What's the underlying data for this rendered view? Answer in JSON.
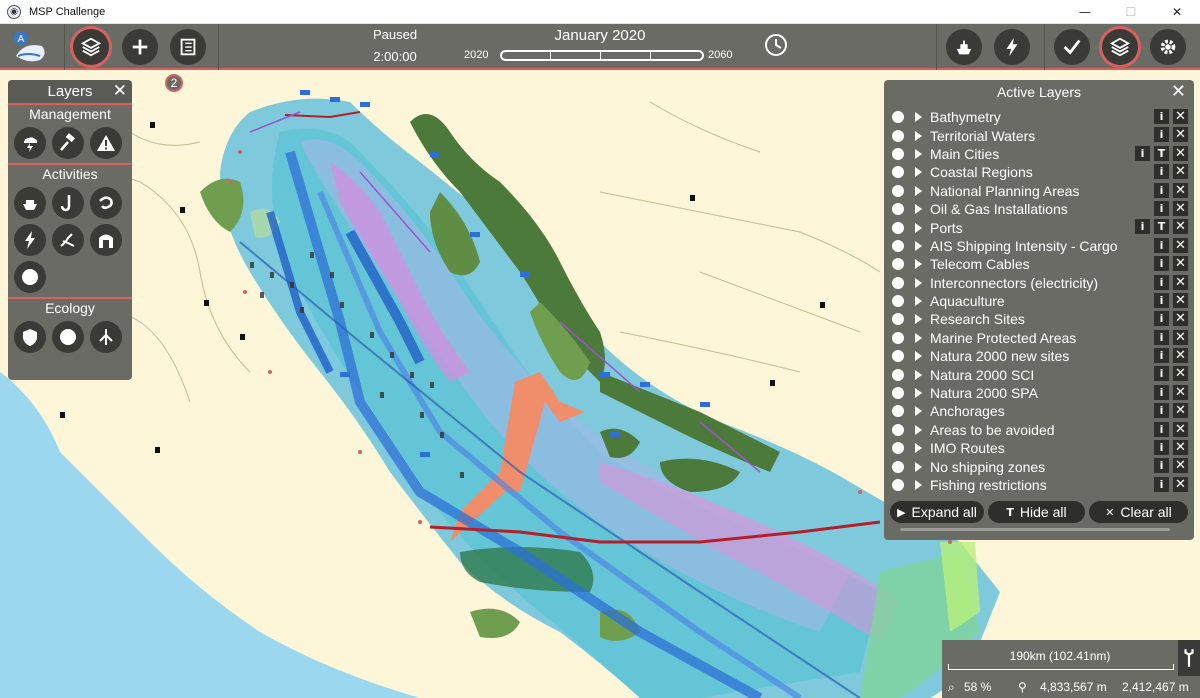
{
  "window": {
    "title": "MSP Challenge",
    "minimize": "—",
    "maximize": "☐",
    "close": "✕"
  },
  "toolbar": {
    "notification_count": "2",
    "time_status": "Paused",
    "time_remaining": "2:00:00",
    "current_date": "January 2020",
    "timeline_start": "2020",
    "timeline_end": "2060"
  },
  "layers_panel": {
    "title": "Layers",
    "close": "✕",
    "sections": {
      "management": {
        "label": "Management",
        "icons": [
          "cloud-lightning-icon",
          "gavel-icon",
          "warning-icon"
        ]
      },
      "activities": {
        "label": "Activities",
        "icons": [
          "ship-icon",
          "fishing-hook-icon",
          "aquaculture-icon",
          "energy-bolt-icon",
          "coast-icon",
          "installation-icon",
          "circle-icon"
        ]
      },
      "ecology": {
        "label": "Ecology",
        "icons": [
          "shield-icon",
          "circle-icon",
          "species-icon"
        ]
      }
    }
  },
  "active_layers": {
    "title": "Active Layers",
    "close": "✕",
    "items": [
      {
        "label": "Bathymetry",
        "info": "i",
        "remove": "✕",
        "text": ""
      },
      {
        "label": "Territorial Waters",
        "info": "i",
        "remove": "✕",
        "text": ""
      },
      {
        "label": "Main Cities",
        "info": "i",
        "remove": "✕",
        "text": "T"
      },
      {
        "label": "Coastal Regions",
        "info": "i",
        "remove": "✕",
        "text": ""
      },
      {
        "label": "National Planning Areas",
        "info": "i",
        "remove": "✕",
        "text": ""
      },
      {
        "label": "Oil & Gas Installations",
        "info": "i",
        "remove": "✕",
        "text": ""
      },
      {
        "label": "Ports",
        "info": "i",
        "remove": "✕",
        "text": "T"
      },
      {
        "label": "AIS Shipping Intensity - Cargo",
        "info": "i",
        "remove": "✕",
        "text": ""
      },
      {
        "label": "Telecom Cables",
        "info": "i",
        "remove": "✕",
        "text": ""
      },
      {
        "label": "Interconnectors (electricity)",
        "info": "i",
        "remove": "✕",
        "text": ""
      },
      {
        "label": "Aquaculture",
        "info": "i",
        "remove": "✕",
        "text": ""
      },
      {
        "label": "Research Sites",
        "info": "i",
        "remove": "✕",
        "text": ""
      },
      {
        "label": "Marine Protected Areas",
        "info": "i",
        "remove": "✕",
        "text": ""
      },
      {
        "label": "Natura 2000 new sites",
        "info": "i",
        "remove": "✕",
        "text": ""
      },
      {
        "label": "Natura 2000 SCI",
        "info": "i",
        "remove": "✕",
        "text": ""
      },
      {
        "label": "Natura 2000 SPA",
        "info": "i",
        "remove": "✕",
        "text": ""
      },
      {
        "label": "Anchorages",
        "info": "i",
        "remove": "✕",
        "text": ""
      },
      {
        "label": "Areas to be avoided",
        "info": "i",
        "remove": "✕",
        "text": ""
      },
      {
        "label": "IMO Routes",
        "info": "i",
        "remove": "✕",
        "text": ""
      },
      {
        "label": "No shipping zones",
        "info": "i",
        "remove": "✕",
        "text": ""
      },
      {
        "label": "Fishing restrictions",
        "info": "i",
        "remove": "✕",
        "text": ""
      }
    ],
    "expand_all": "Expand all",
    "hide_all": "Hide all",
    "clear_all": "Clear all",
    "expand_icon": "▶",
    "hide_icon": "T",
    "clear_icon": "✕"
  },
  "map_info": {
    "scale": "190km (102.41nm)",
    "zoom": "58 %",
    "coord_x": "4,833,567 m",
    "coord_y": "2,412,467 m"
  },
  "colors": {
    "panel_bg": "#6b6b66",
    "accent": "#d8615f",
    "land": "#fdf6d8",
    "sea": "#8fd0ea"
  }
}
